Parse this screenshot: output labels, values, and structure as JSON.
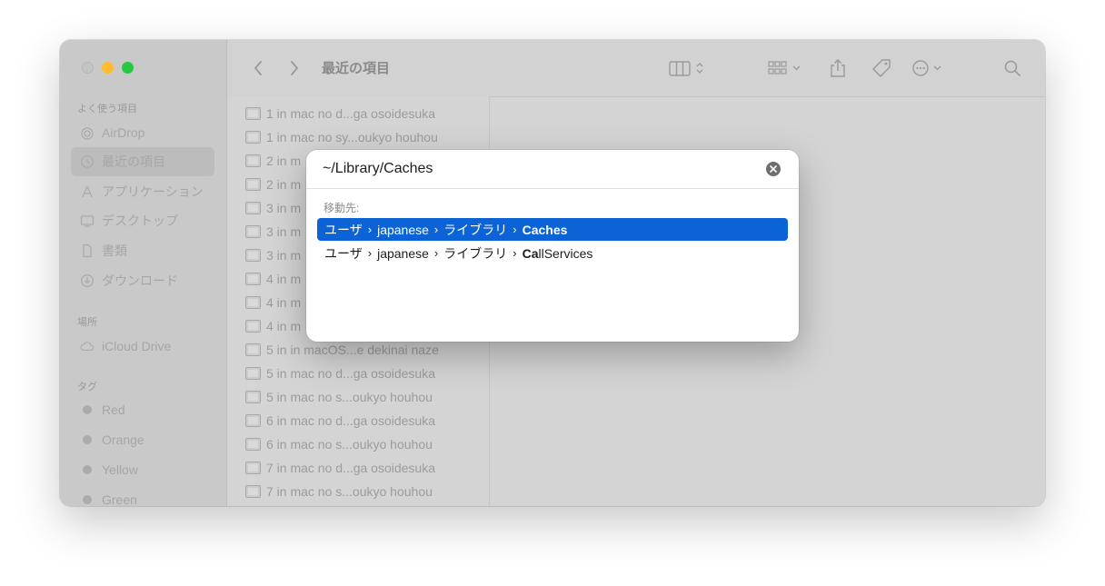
{
  "window": {
    "title": "最近の項目"
  },
  "sidebar": {
    "favorites_title": "よく使う項目",
    "favorites": [
      {
        "label": "AirDrop",
        "icon": "airdrop-icon"
      },
      {
        "label": "最近の項目",
        "icon": "clock-icon",
        "selected": true
      },
      {
        "label": "アプリケーション",
        "icon": "applications-icon"
      },
      {
        "label": "デスクトップ",
        "icon": "desktop-icon"
      },
      {
        "label": "書類",
        "icon": "document-icon"
      },
      {
        "label": "ダウンロード",
        "icon": "download-icon"
      }
    ],
    "locations_title": "場所",
    "locations": [
      {
        "label": "iCloud Drive",
        "icon": "cloud-icon"
      }
    ],
    "tags_title": "タグ",
    "tags": [
      {
        "label": "Red"
      },
      {
        "label": "Orange"
      },
      {
        "label": "Yellow"
      },
      {
        "label": "Green"
      }
    ]
  },
  "files": [
    "1 in mac no d...ga osoidesuka",
    "1 in mac no sy...oukyo houhou",
    "2  in m",
    "2 in m",
    "3 in m",
    "3 in m",
    "3 in m",
    "4  in m",
    "4 in m",
    "4 in m",
    "5 in in macOS...e dekinai naze",
    "5 in mac no d...ga osoidesuka",
    "5 in mac no s...oukyo houhou",
    "6 in mac no d...ga osoidesuka",
    "6 in mac no s...oukyo houhou",
    "7 in mac no d...ga osoidesuka",
    "7 in mac no s...oukyo houhou"
  ],
  "goto_dialog": {
    "path_value": "~/Library/Caches",
    "section_label": "移動先:",
    "suggestions": [
      {
        "crumbs": [
          "ユーザ",
          "japanese",
          "ライブラリ"
        ],
        "last_match": "Caches",
        "last_rest": "",
        "active": true
      },
      {
        "crumbs": [
          "ユーザ",
          "japanese",
          "ライブラリ"
        ],
        "last_match": "Ca",
        "last_rest": "llServices",
        "active": false
      }
    ]
  },
  "colors": {
    "selection_blue": "#0b63d6",
    "traffic_min": "#febc2e",
    "traffic_max": "#28c840"
  }
}
